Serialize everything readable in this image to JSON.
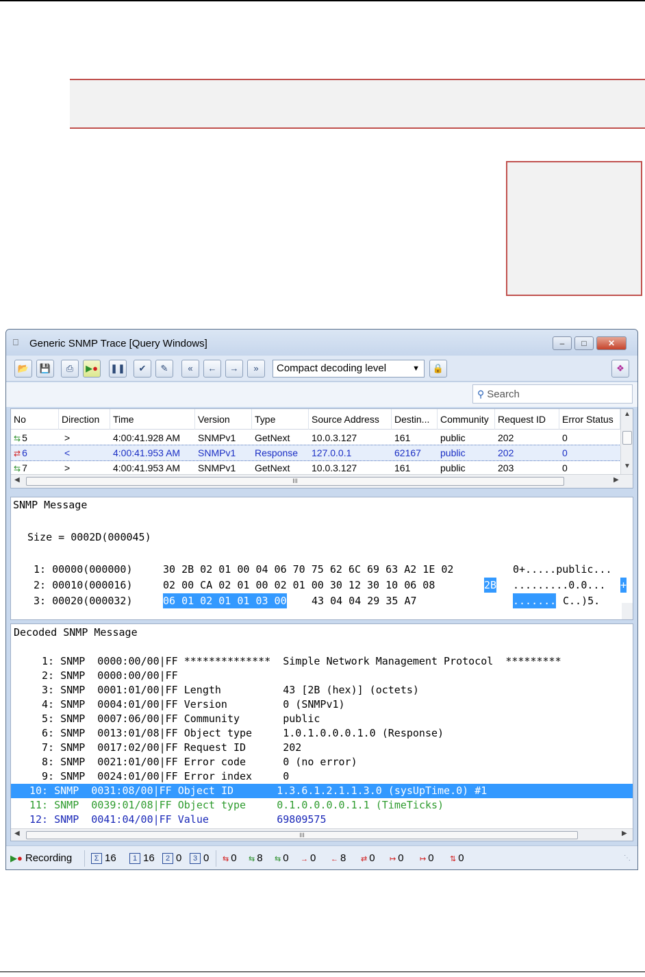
{
  "window": {
    "title": "Generic SNMP Trace [Query Windows]",
    "decoding_level": "Compact decoding level",
    "search_placeholder": "Search",
    "minimize_glyph": "–",
    "maximize_glyph": "□",
    "close_glyph": "✕"
  },
  "toolbar": {
    "buttons": [
      "open-icon",
      "save-icon",
      "print-icon",
      "record-icon",
      "pause-icon",
      "clear-icon",
      "properties-icon",
      "first-icon",
      "previous-icon",
      "next-icon",
      "last-icon",
      "lock-icon",
      "filter-icon"
    ]
  },
  "grid": {
    "columns": [
      "No",
      "Direction",
      "Time",
      "Version",
      "Type",
      "Source Address",
      "Destin...",
      "Community",
      "Request ID",
      "Error Status"
    ],
    "rows": [
      {
        "no": "5",
        "direction": ">",
        "time": "4:00:41.928 AM",
        "version": "SNMPv1",
        "type": "GetNext",
        "source": "10.0.3.127",
        "dest": "161",
        "community": "public",
        "request_id": "202",
        "error_status": "0"
      },
      {
        "no": "6",
        "direction": "<",
        "time": "4:00:41.953 AM",
        "version": "SNMPv1",
        "type": "Response",
        "source": "127.0.0.1",
        "dest": "62167",
        "community": "public",
        "request_id": "202",
        "error_status": "0"
      },
      {
        "no": "7",
        "direction": ">",
        "time": "4:00:41.953 AM",
        "version": "SNMPv1",
        "type": "GetNext",
        "source": "10.0.3.127",
        "dest": "161",
        "community": "public",
        "request_id": "203",
        "error_status": "0"
      }
    ],
    "scroll_grip": "III"
  },
  "hex": {
    "title": "SNMP Message",
    "size_line": "Size = 0002D(000045)",
    "line1": {
      "prefix": "1: 00000(000000)",
      "bytes": "30 2B 02 01 00 04 06 70 75 62 6C 69 63 A2 1E 02",
      "ascii": "0+.....public..."
    },
    "line2": {
      "prefix": "2: 00010(000016)",
      "bytes": "02 00 CA 02 01 00 02 01 00 30 12 30 10 06 08",
      "bytes_hl": "2B",
      "ascii": ".........0.0...",
      "ascii_hl": "+"
    },
    "line3": {
      "prefix": "3: 00020(000032)",
      "bytes_hl": "06 01 02 01 01 03 00",
      "bytes": "43 04 04 29 35 A7",
      "ascii_hl": ".......",
      "ascii": "C..)5."
    }
  },
  "decoded": {
    "title": "Decoded SNMP Message",
    "lines": [
      " 1: SNMP  0000:00/00|FF **************  Simple Network Management Protocol  *********",
      " 2: SNMP  0000:00/00|FF",
      " 3: SNMP  0001:01/00|FF Length          43 [2B (hex)] (octets)",
      " 4: SNMP  0004:01/00|FF Version         0 (SNMPv1)",
      " 5: SNMP  0007:06/00|FF Community       public",
      " 6: SNMP  0013:01/08|FF Object type     1.0.1.0.0.0.1.0 (Response)",
      " 7: SNMP  0017:02/00|FF Request ID      202",
      " 8: SNMP  0021:01/00|FF Error code      0 (no error)",
      " 9: SNMP  0024:01/00|FF Error index     0",
      "10: SNMP  0031:08/00|FF Object ID       1.3.6.1.2.1.1.3.0 (sysUpTime.0) #1",
      "11: SNMP  0039:01/08|FF Object type     0.1.0.0.0.0.1.1 (TimeTicks)",
      "12: SNMP  0041:04/00|FF Value           69809575"
    ],
    "scroll_grip": "III"
  },
  "status": {
    "recording": "Recording",
    "total_icon": "Σ",
    "total": "16",
    "v1_label": "1",
    "v1": "16",
    "v2_label": "2",
    "v2": "0",
    "v3_label": "3",
    "v3": "0",
    "counts": [
      "0",
      "8",
      "0",
      "0",
      "8",
      "0",
      "0",
      "0",
      "0"
    ]
  },
  "colors": {
    "accent_box": "#c0504d",
    "selection": "#3399ff",
    "response_text": "#1a2ec4",
    "green_text": "#2d9b2d"
  }
}
